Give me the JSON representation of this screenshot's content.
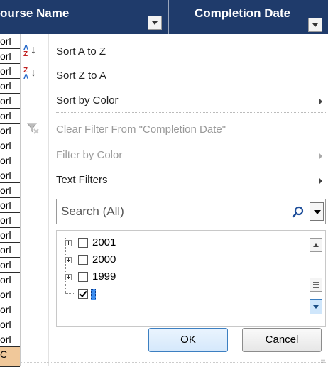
{
  "header": {
    "course_name": "ourse Name",
    "completion_date": "Completion Date"
  },
  "cells": {
    "text": "orl",
    "last": "C"
  },
  "menu": {
    "sort_az": "Sort A to Z",
    "sort_za": "Sort Z to A",
    "sort_by_color": "Sort by Color",
    "clear_filter": "Clear Filter From \"Completion Date\"",
    "filter_by_color": "Filter by Color",
    "text_filters": "Text Filters",
    "sort_az_icon_top": "A",
    "sort_az_icon_bottom": "Z",
    "sort_za_icon_top": "Z",
    "sort_za_icon_bottom": "A"
  },
  "search": {
    "placeholder": "Search (All)"
  },
  "tree": {
    "items": [
      {
        "label": "2001",
        "checked": false
      },
      {
        "label": "2000",
        "checked": false
      },
      {
        "label": "1999",
        "checked": false
      },
      {
        "label": "",
        "checked": true
      }
    ]
  },
  "buttons": {
    "ok": "OK",
    "cancel": "Cancel"
  },
  "colors": {
    "header_bg": "#1f3b6b",
    "accent": "#3c7fc1"
  }
}
